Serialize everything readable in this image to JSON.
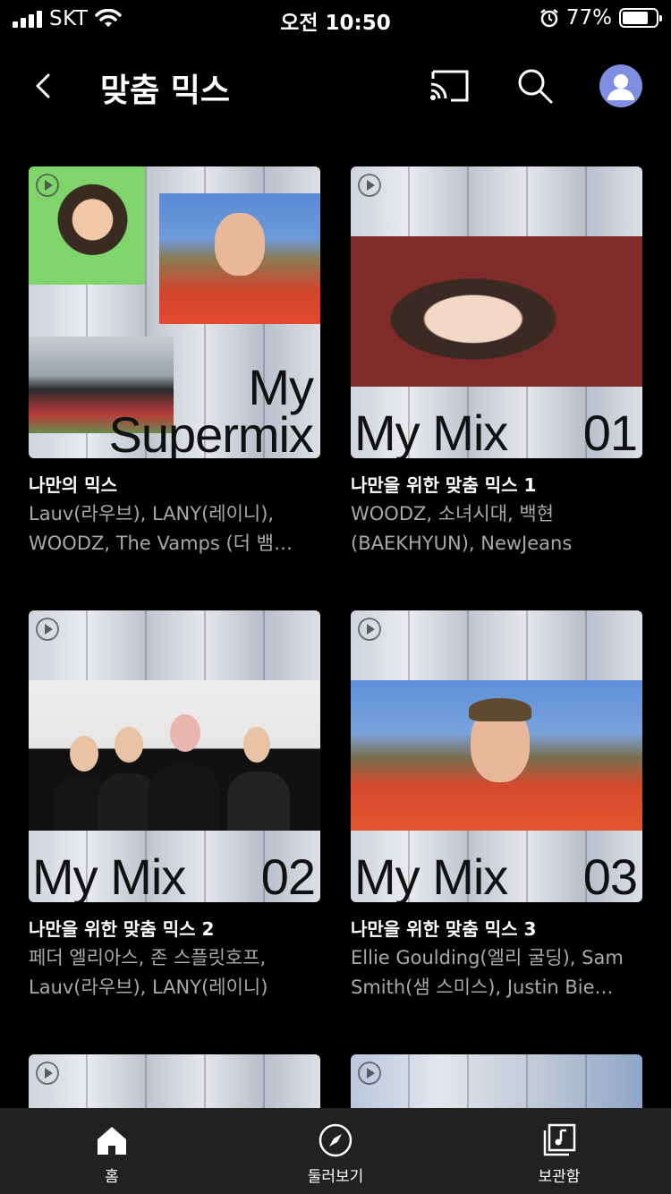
{
  "status_bar": {
    "carrier": "SKT",
    "time": "오전 10:50",
    "battery": "77%",
    "battery_level": 0.77
  },
  "header": {
    "title": "맞춤 믹스"
  },
  "mixes": [
    {
      "title": "나만의 믹스",
      "artists": "Lauv(라우브), LANY(레이니), WOODZ, The Vamps (더 뱀…",
      "cover_word_1": "My",
      "cover_word_2": "Supermix"
    },
    {
      "title": "나만을 위한 맞춤 믹스 1",
      "artists": "WOODZ, 소녀시대, 백현(BAEKHYUN), NewJeans",
      "cover_word": "My Mix",
      "cover_number": "01"
    },
    {
      "title": "나만을 위한 맞춤 믹스 2",
      "artists": "페더 엘리아스, 존 스플릿호프, Lauv(라우브), LANY(레이니)",
      "cover_word": "My Mix",
      "cover_number": "02"
    },
    {
      "title": "나만을 위한 맞춤 믹스 3",
      "artists": "Ellie Goulding(엘리 굴딩), Sam Smith(샘 스미스), Justin Bie…",
      "cover_word": "My Mix",
      "cover_number": "03"
    }
  ],
  "bottom_nav": {
    "items": [
      {
        "label": "홈",
        "icon": "home-icon"
      },
      {
        "label": "둘러보기",
        "icon": "compass-icon"
      },
      {
        "label": "보관함",
        "icon": "library-icon"
      }
    ]
  }
}
